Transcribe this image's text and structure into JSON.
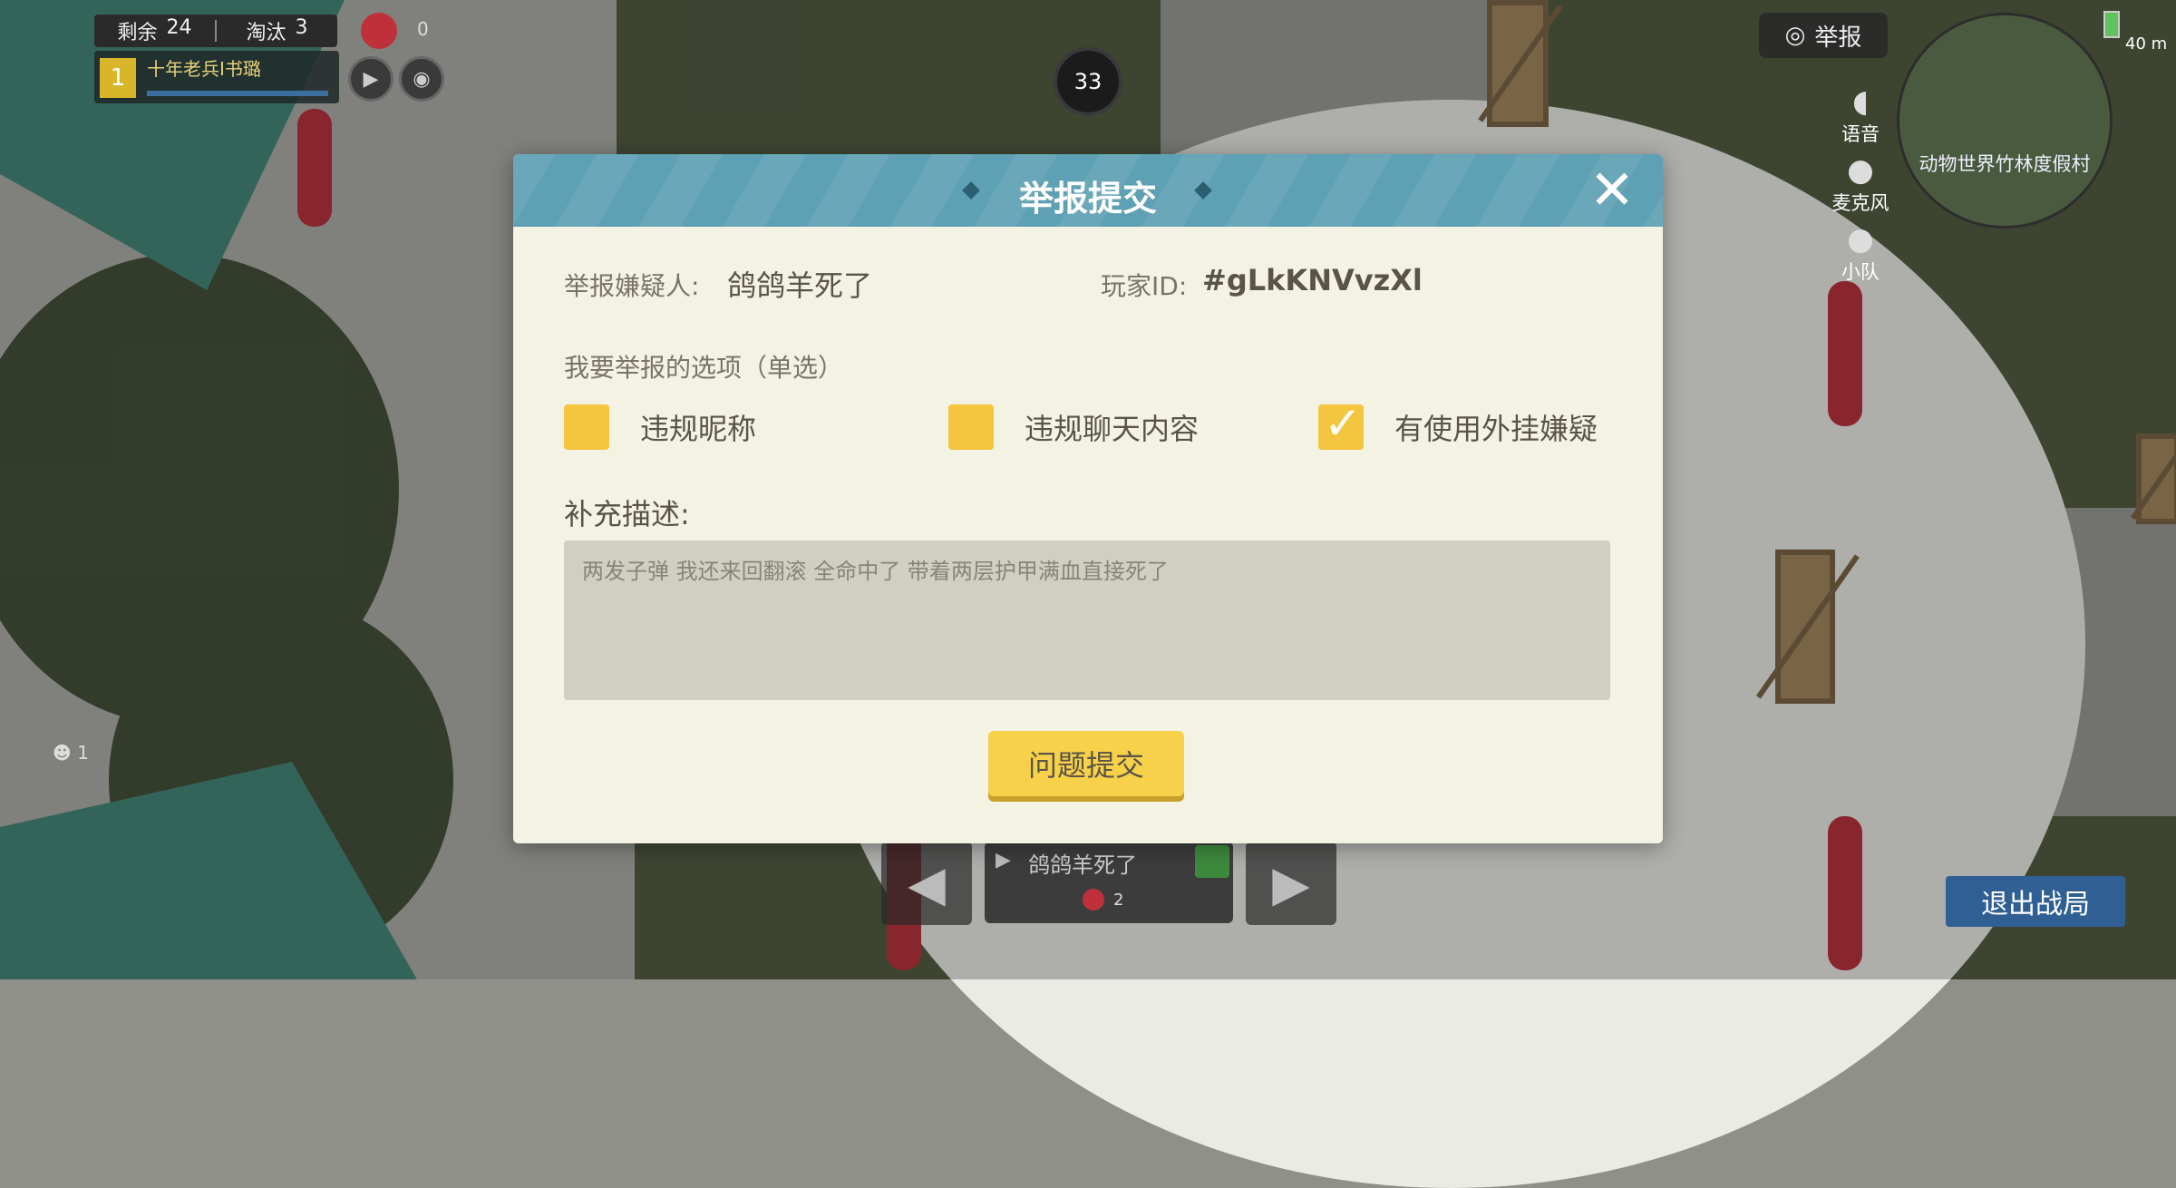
{
  "hud": {
    "remaining_label": "剩余",
    "remaining_value": "24",
    "eliminated_label": "淘汰",
    "eliminated_value": "3",
    "team_rank": "1",
    "team_player": "十年老兵I书璐",
    "item_count": "0",
    "timer": "33",
    "spectator_count": "1",
    "report_label": "举报"
  },
  "side_controls": [
    {
      "icon": "speaker-icon",
      "label": "语音"
    },
    {
      "icon": "microphone-icon",
      "label": "麦克风"
    },
    {
      "icon": "microphone-icon",
      "label": "小队"
    }
  ],
  "status": {
    "distance": "40 m"
  },
  "minimap": {
    "location": "动物世界竹林度假村"
  },
  "spectate": {
    "player_name": "鸽鸽羊死了",
    "count": "2"
  },
  "exit_label": "退出战局",
  "dialog": {
    "title": "举报提交",
    "suspect_label": "举报嫌疑人:",
    "suspect_name": "鸽鸽羊死了",
    "player_id_label": "玩家ID:",
    "player_id": "#gLkKNVvzXl",
    "options_label": "我要举报的选项（单选）",
    "options": [
      {
        "label": "违规昵称",
        "checked": false
      },
      {
        "label": "违规聊天内容",
        "checked": false
      },
      {
        "label": "有使用外挂嫌疑",
        "checked": true
      }
    ],
    "description_label": "补充描述:",
    "description_text": "两发子弹  我还来回翻滚  全命中了  带着两层护甲满血直接死了",
    "submit_label": "问题提交"
  },
  "colors": {
    "header": "#5ea0b4",
    "panel": "#f3f2e3",
    "checkbox": "#f4c53e",
    "submit": "#f8d14a",
    "exit_button": "#2f5f93"
  }
}
